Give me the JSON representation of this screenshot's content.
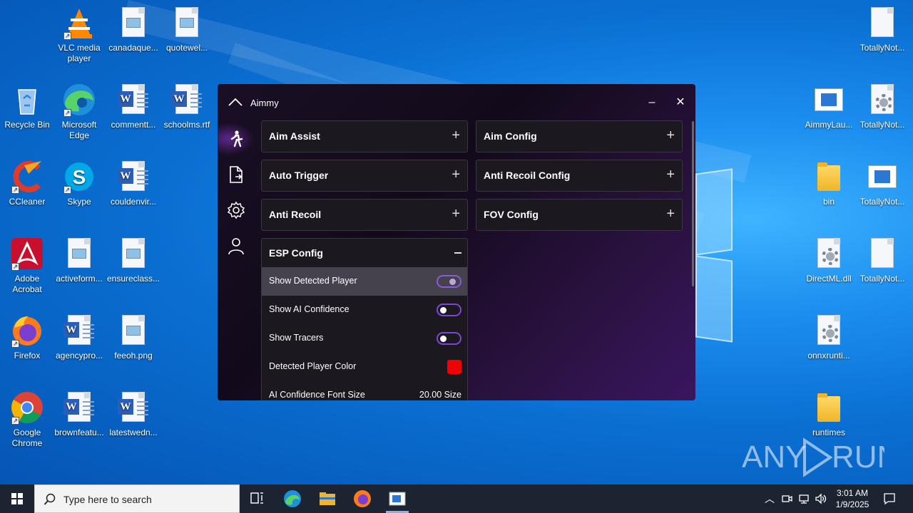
{
  "desktop": {
    "icons_left": [
      {
        "label_lines": [
          "VLC media",
          "player"
        ],
        "kind": "vlc"
      },
      {
        "label_lines": [
          "canadaque..."
        ],
        "kind": "image-doc"
      },
      {
        "label_lines": [
          "quotewel..."
        ],
        "kind": "image-doc"
      },
      {
        "label_lines": [
          "Recycle Bin"
        ],
        "kind": "recycle-bin"
      },
      {
        "label_lines": [
          "Microsoft",
          "Edge"
        ],
        "kind": "edge"
      },
      {
        "label_lines": [
          "commentt..."
        ],
        "kind": "word-doc"
      },
      {
        "label_lines": [
          "schoolms.rtf"
        ],
        "kind": "word-doc"
      },
      {
        "label_lines": [
          "CCleaner"
        ],
        "kind": "ccleaner"
      },
      {
        "label_lines": [
          "Skype"
        ],
        "kind": "skype"
      },
      {
        "label_lines": [
          "couldenvir..."
        ],
        "kind": "word-doc"
      },
      {
        "label_lines": [
          "Adobe",
          "Acrobat"
        ],
        "kind": "acrobat"
      },
      {
        "label_lines": [
          "activeform..."
        ],
        "kind": "image-doc"
      },
      {
        "label_lines": [
          "ensureclass..."
        ],
        "kind": "image-doc"
      },
      {
        "label_lines": [
          "Firefox"
        ],
        "kind": "firefox"
      },
      {
        "label_lines": [
          "agencypro..."
        ],
        "kind": "word-doc"
      },
      {
        "label_lines": [
          "feeoh.png"
        ],
        "kind": "image-doc"
      },
      {
        "label_lines": [
          "Google",
          "Chrome"
        ],
        "kind": "chrome"
      },
      {
        "label_lines": [
          "brownfeatu..."
        ],
        "kind": "word-doc"
      },
      {
        "label_lines": [
          "latestwedn..."
        ],
        "kind": "word-doc"
      }
    ],
    "icons_right": [
      {
        "label_lines": [
          "TotallyNot..."
        ],
        "kind": "blank-doc"
      },
      {
        "label_lines": [
          "AimmyLau..."
        ],
        "kind": "app-window"
      },
      {
        "label_lines": [
          "TotallyNot..."
        ],
        "kind": "settings-doc"
      },
      {
        "label_lines": [
          "bin"
        ],
        "kind": "folder"
      },
      {
        "label_lines": [
          "TotallyNot..."
        ],
        "kind": "app-window"
      },
      {
        "label_lines": [
          "DirectML.dll"
        ],
        "kind": "settings-doc"
      },
      {
        "label_lines": [
          "TotallyNot..."
        ],
        "kind": "blank-doc"
      },
      {
        "label_lines": [
          "onnxrunti..."
        ],
        "kind": "settings-doc"
      },
      {
        "label_lines": [
          "runtimes"
        ],
        "kind": "folder"
      }
    ]
  },
  "aimmy": {
    "title": "Aimmy",
    "minimize_label": "–",
    "close_label": "✕",
    "sidebar_icons": [
      "aim-figure-icon",
      "document-icon",
      "settings-gear-icon",
      "user-icon"
    ],
    "left_cards": [
      {
        "title": "Aim Assist",
        "toggle": "+"
      },
      {
        "title": "Auto Trigger",
        "toggle": "+"
      },
      {
        "title": "Anti Recoil",
        "toggle": "+"
      }
    ],
    "right_cards": [
      {
        "title": "Aim Config",
        "toggle": "+"
      },
      {
        "title": "Anti Recoil Config",
        "toggle": "+"
      },
      {
        "title": "FOV Config",
        "toggle": "+"
      }
    ],
    "esp": {
      "title": "ESP Config",
      "rows": [
        {
          "label": "Show Detected Player",
          "type": "toggle",
          "on": false,
          "highlighted": true
        },
        {
          "label": "Show AI Confidence",
          "type": "toggle",
          "on": false
        },
        {
          "label": "Show Tracers",
          "type": "toggle",
          "on": false
        },
        {
          "label": "Detected Player Color",
          "type": "color",
          "color": "#f00000"
        },
        {
          "label": "AI Confidence Font Size",
          "type": "value",
          "value": "20.00 Size"
        }
      ]
    },
    "accent_color": "#7d45d8"
  },
  "watermark": {
    "text": "ANY RUN"
  },
  "taskbar": {
    "search_placeholder": "Type here to search",
    "clock_time": "3:01 AM",
    "clock_date": "1/9/2025"
  }
}
